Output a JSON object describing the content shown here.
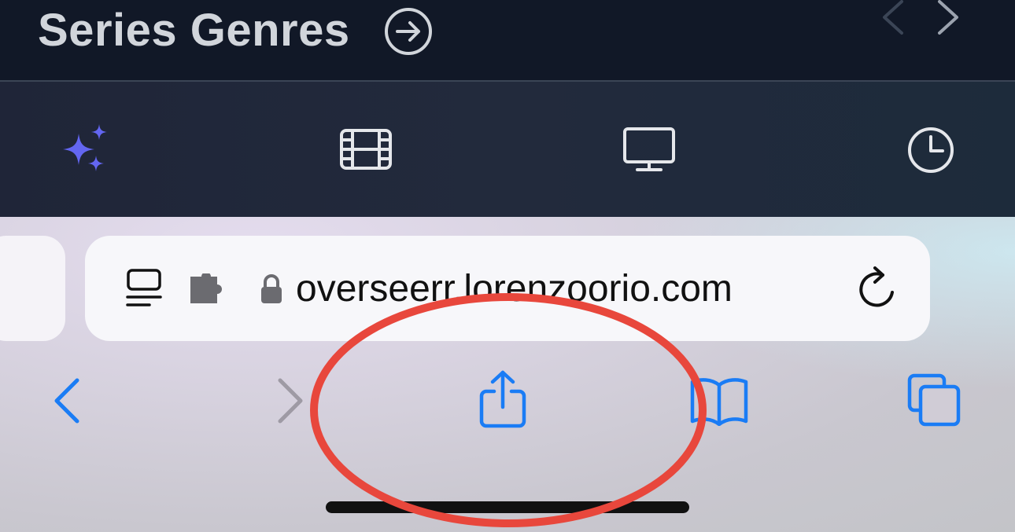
{
  "section": {
    "title": "Series Genres",
    "arrow_icon": "arrow-circle-right-icon",
    "slider_controls": [
      "chevron-left-icon",
      "chevron-right-icon"
    ]
  },
  "mobile_nav": {
    "items": [
      {
        "icon": "sparkles-icon",
        "active": true
      },
      {
        "icon": "film-icon",
        "active": false
      },
      {
        "icon": "tv-icon",
        "active": false
      },
      {
        "icon": "clock-icon",
        "active": false
      }
    ],
    "active_color": "#6366f1"
  },
  "address_bar": {
    "url": "overseerr.lorenzoorio.com",
    "icons": [
      "reader-mode-icon",
      "extension-icon",
      "lock-icon",
      "reload-icon"
    ]
  },
  "toolbar": {
    "buttons": [
      "back-icon",
      "forward-icon",
      "share-icon",
      "bookmarks-icon",
      "tabs-icon"
    ],
    "forward_enabled": false,
    "accent": "#1a7cf5"
  },
  "annotation": {
    "shape": "ellipse",
    "color": "#e8473c",
    "target": "share-button"
  }
}
